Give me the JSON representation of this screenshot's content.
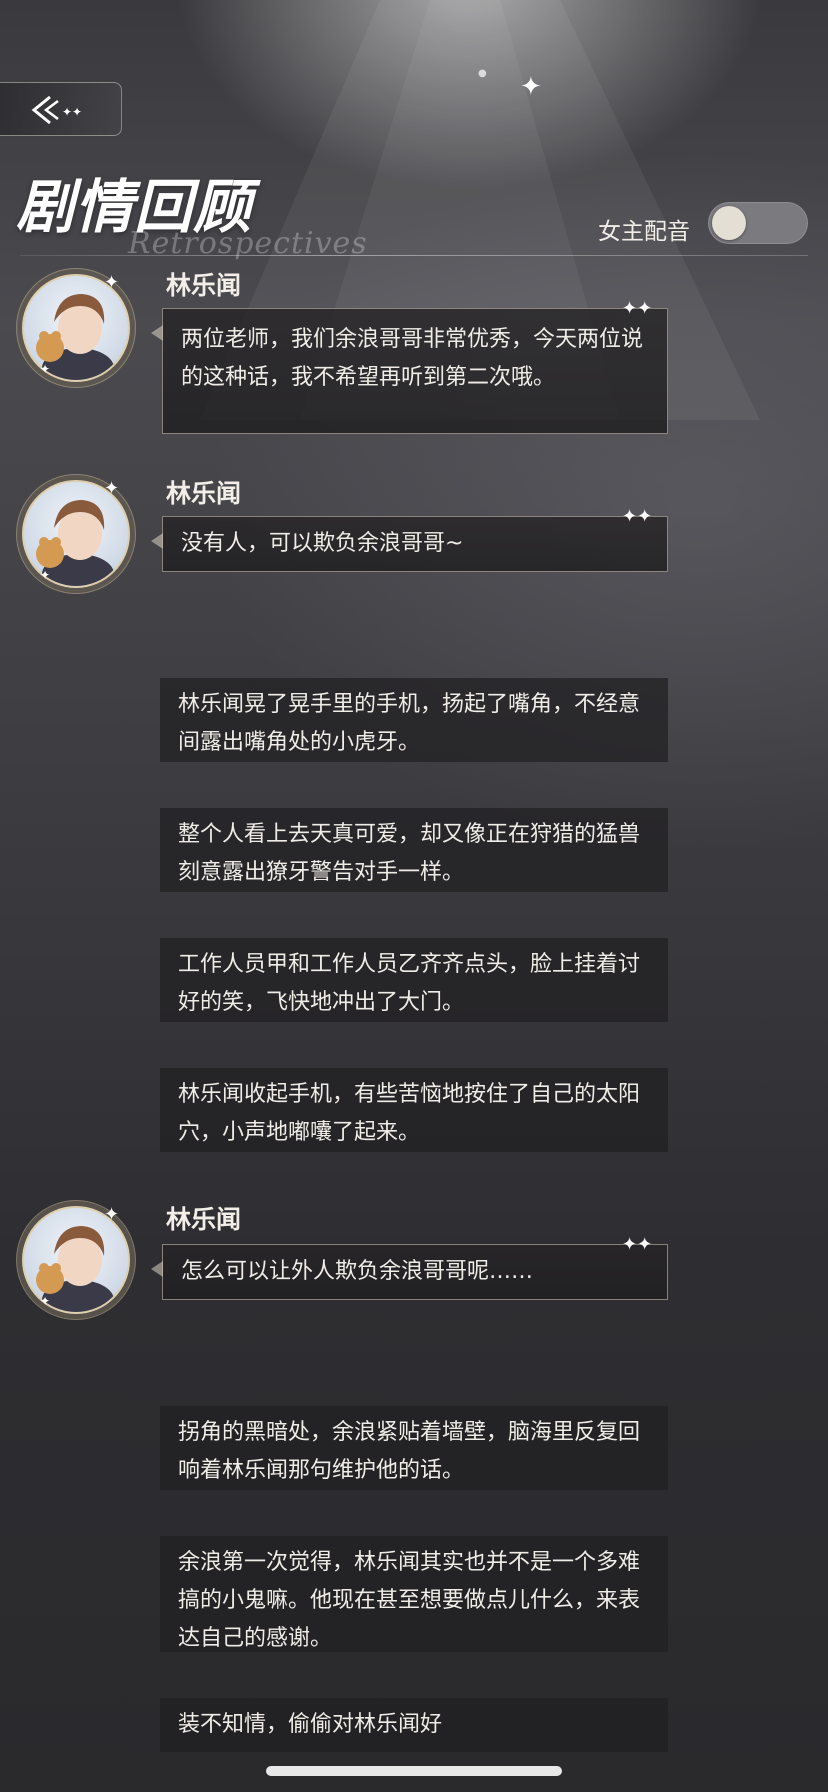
{
  "header": {
    "title": "剧情回顾",
    "subtitle": "Retrospectives",
    "back_icon": "back-arrow-icon",
    "voice_label": "女主配音",
    "voice_toggle_on": false
  },
  "entries": [
    {
      "type": "dialogue",
      "speaker": "林乐闻",
      "text": "两位老师，我们余浪哥哥非常优秀，今天两位说的这种话，我不希望再听到第二次哦。"
    },
    {
      "type": "dialogue",
      "speaker": "林乐闻",
      "text": "没有人，可以欺负余浪哥哥~"
    },
    {
      "type": "narration",
      "text": "林乐闻晃了晃手里的手机，扬起了嘴角，不经意间露出嘴角处的小虎牙。"
    },
    {
      "type": "narration",
      "text": "整个人看上去天真可爱，却又像正在狩猎的猛兽刻意露出獠牙警告对手一样。"
    },
    {
      "type": "narration",
      "text": "工作人员甲和工作人员乙齐齐点头，脸上挂着讨好的笑，飞快地冲出了大门。"
    },
    {
      "type": "narration",
      "text": "林乐闻收起手机，有些苦恼地按住了自己的太阳穴，小声地嘟囔了起来。"
    },
    {
      "type": "dialogue",
      "speaker": "林乐闻",
      "text": "怎么可以让外人欺负余浪哥哥呢……"
    },
    {
      "type": "narration",
      "text": "拐角的黑暗处，余浪紧贴着墙壁，脑海里反复回响着林乐闻那句维护他的话。"
    },
    {
      "type": "narration",
      "text": "余浪第一次觉得，林乐闻其实也并不是一个多难搞的小鬼嘛。他现在甚至想要做点儿什么，来表达自己的感谢。"
    },
    {
      "type": "narration",
      "text": "装不知情，偷偷对林乐闻好"
    }
  ]
}
